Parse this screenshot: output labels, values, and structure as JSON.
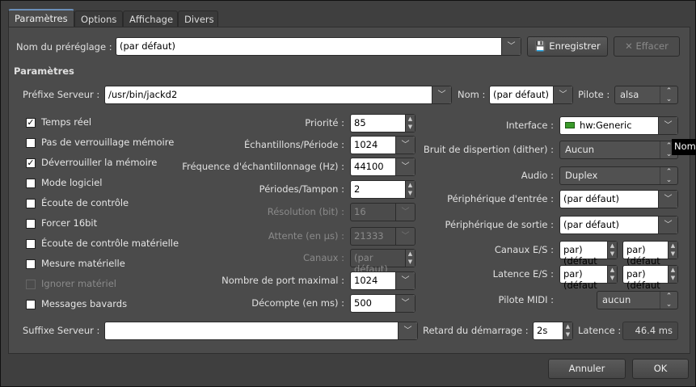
{
  "tabs": [
    "Paramètres",
    "Options",
    "Affichage",
    "Divers"
  ],
  "preset": {
    "label": "Nom du préréglage :",
    "value": "(par défaut)",
    "save": "Enregistrer",
    "delete": "Effacer"
  },
  "section": "Paramètres",
  "server_prefix": {
    "label": "Préfixe Serveur :",
    "value": "/usr/bin/jackd2"
  },
  "name": {
    "label": "Nom :",
    "value": "(par défaut)"
  },
  "driver": {
    "label": "Pilote :",
    "value": "alsa"
  },
  "checkboxes": [
    {
      "label": "Temps réel",
      "checked": true,
      "enabled": true
    },
    {
      "label": "Pas de verrouillage mémoire",
      "checked": false,
      "enabled": true
    },
    {
      "label": "Déverrouiller la mémoire",
      "checked": true,
      "enabled": true
    },
    {
      "label": "Mode logiciel",
      "checked": false,
      "enabled": true
    },
    {
      "label": "Écoute de contrôle",
      "checked": false,
      "enabled": true
    },
    {
      "label": "Forcer 16bit",
      "checked": false,
      "enabled": true
    },
    {
      "label": "Écoute de contrôle matérielle",
      "checked": false,
      "enabled": true
    },
    {
      "label": "Mesure matérielle",
      "checked": false,
      "enabled": true
    },
    {
      "label": "Ignorer matériel",
      "checked": false,
      "enabled": false
    },
    {
      "label": "Messages bavards",
      "checked": false,
      "enabled": true
    }
  ],
  "mid": {
    "priority": {
      "label": "Priorité :",
      "value": "85"
    },
    "frames": {
      "label": "Échantillons/Période :",
      "value": "1024"
    },
    "rate": {
      "label": "Fréquence d'échantillonnage (Hz) :",
      "value": "44100"
    },
    "periods": {
      "label": "Périodes/Tampon :",
      "value": "2"
    },
    "wordlength": {
      "label": "Résolution (bit) :",
      "value": "16"
    },
    "wait": {
      "label": "Attente (en µs) :",
      "value": "21333"
    },
    "chan": {
      "label": "Canaux :",
      "value": "(par défaut)"
    },
    "ports": {
      "label": "Nombre de port maximal :",
      "value": "1024"
    },
    "timeout": {
      "label": "Décompte (en ms) :",
      "value": "500"
    }
  },
  "right": {
    "interface": {
      "label": "Interface :",
      "value": "hw:Generic"
    },
    "dither": {
      "label": "Bruit de dispertion (dither) :",
      "value": "Aucun"
    },
    "audio": {
      "label": "Audio :",
      "value": "Duplex"
    },
    "indev": {
      "label": "Périphérique d'entrée :",
      "value": "(par défaut)"
    },
    "outdev": {
      "label": "Périphérique de sortie :",
      "value": "(par défaut)"
    },
    "chan_io": {
      "label": "Canaux E/S :",
      "in": "(par défaut)",
      "out": "(par défaut)"
    },
    "lat_io": {
      "label": "Latence E/S :",
      "in": "(par défaut)",
      "out": "(par défaut)"
    },
    "midi": {
      "label": "Pilote MIDI :",
      "value": "aucun"
    }
  },
  "tooltip": "Nom",
  "suffix": {
    "label": "Suffixe Serveur :",
    "value": ""
  },
  "start_delay": {
    "label": "Retard du démarrage :",
    "value": "2s"
  },
  "latency": {
    "label": "Latence :",
    "value": "46.4 ms"
  },
  "buttons": {
    "cancel": "Annuler",
    "ok": "OK"
  }
}
